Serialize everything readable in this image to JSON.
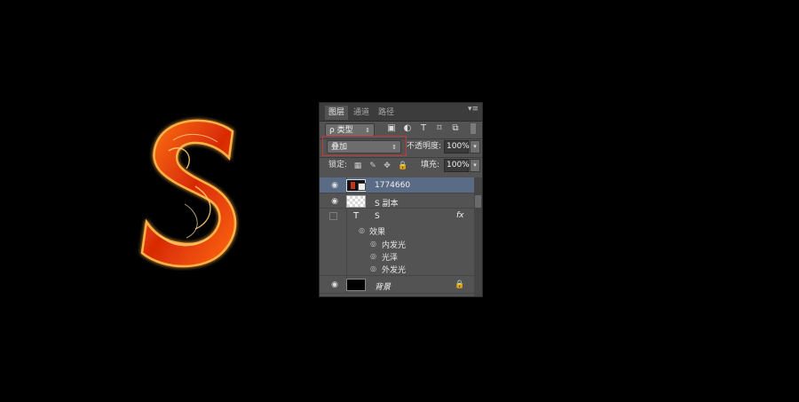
{
  "panel": {
    "tabs": [
      {
        "label": "图层",
        "active": true
      },
      {
        "label": "通道",
        "active": false
      },
      {
        "label": "路径",
        "active": false
      }
    ],
    "filter": {
      "label": "ρ 类型"
    },
    "blend_mode": {
      "value": "叠加"
    },
    "opacity": {
      "label": "不透明度:",
      "value": "100%"
    },
    "lock": {
      "label": "锁定:"
    },
    "fill": {
      "label": "填充:",
      "value": "100%"
    },
    "layers": [
      {
        "name": "1774660",
        "selected": true,
        "visible": true
      },
      {
        "name": "S 副本",
        "selected": false,
        "visible": true
      },
      {
        "name": "S",
        "selected": false,
        "visible": false,
        "type_icon": "T",
        "fx": "fx",
        "effects_label": "效果",
        "effects": [
          "内发光",
          "光泽",
          "外发光"
        ]
      },
      {
        "name": "背景",
        "selected": false,
        "visible": true
      }
    ]
  },
  "colors": {
    "panel_bg": "#535353",
    "selected_row": "#5a6b86",
    "highlight_border": "#c63a3a",
    "fire_core": "#ffd27a",
    "fire_mid": "#ff5a10",
    "fire_edge": "#b01800"
  }
}
